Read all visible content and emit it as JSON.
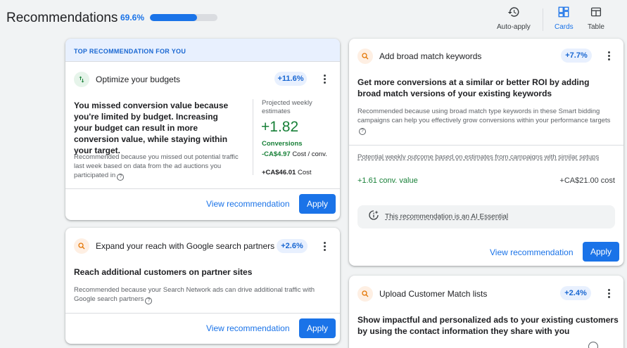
{
  "header": {
    "title": "Recommendations",
    "optimization_score": "69.6%",
    "optimization_fraction": 0.696
  },
  "toolbar": {
    "auto_apply_label": "Auto-apply",
    "cards_label": "Cards",
    "table_label": "Table"
  },
  "cards": {
    "budgets": {
      "banner": "TOP RECOMMENDATION FOR YOU",
      "title": "Optimize your budgets",
      "uplift": "+11.6%",
      "headline": "You missed conversion value because you're limited by budget. Increasing your budget can result in more conversion value, while staying within your target.",
      "reason": "Recommended because you missed out potential traffic last week based on data from the ad auctions you participated in",
      "projected_label": "Projected weekly estimates",
      "projected_value": "+1.82",
      "projected_metric": "Conversions",
      "cost_change": "-CA$4.97",
      "cost_change_suffix": "Cost / conv.",
      "cost_total": "+CA$46.01",
      "cost_total_suffix": "Cost",
      "view_label": "View recommendation",
      "apply_label": "Apply"
    },
    "partners": {
      "title": "Expand your reach with Google search partners",
      "uplift": "+2.6%",
      "headline": "Reach additional customers on partner sites",
      "reason": "Recommended because your Search Network ads can drive additional traffic with Google search partners",
      "view_label": "View recommendation",
      "apply_label": "Apply"
    },
    "broad_match": {
      "title": "Add broad match keywords",
      "uplift": "+7.7%",
      "headline": "Get more conversions at a similar or better ROI by adding broad match versions of your existing keywords",
      "reason": "Recommended because using broad match type keywords in these Smart bidding campaigns can help you effectively grow conversions within your performance targets",
      "outcome_label": "Potential weekly outcome based on estimates from campaigns with similar setups",
      "outcome_conv": "+1.61 conv. value",
      "outcome_cost": "+CA$21.00 cost",
      "ai_essential": "This recommendation is an AI Essential",
      "view_label": "View recommendation",
      "apply_label": "Apply"
    },
    "customer_match": {
      "title": "Upload Customer Match lists",
      "uplift": "+2.4%",
      "headline": "Show impactful and personalized ads to your existing customers by using the contact information they share with you"
    }
  },
  "colors": {
    "accent": "#1a73e8",
    "positive": "#188038",
    "chip_bg": "#e8f0fe"
  },
  "icons": {
    "auto_apply": "history-icon",
    "cards": "dashboard-icon",
    "table": "table-icon",
    "budgets": "swap-vert-icon",
    "search": "search-icon",
    "more": "more-vert-icon",
    "help": "help-icon",
    "ai": "sparkle-icon"
  }
}
